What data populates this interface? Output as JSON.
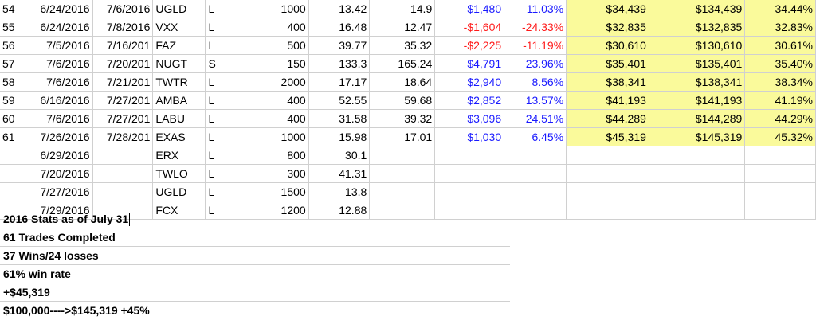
{
  "trades": [
    {
      "num": "54",
      "entry": "6/24/2016",
      "exit": "7/6/2016",
      "ticker": "UGLD",
      "side": "L",
      "shares": "1000",
      "buy": "13.42",
      "sell": "14.9",
      "pl": "$1,480",
      "pct": "11.03%",
      "cum": "$34,439",
      "bal": "$134,439",
      "ytd": "34.44%",
      "sign": "pos"
    },
    {
      "num": "55",
      "entry": "6/24/2016",
      "exit": "7/8/2016",
      "ticker": "VXX",
      "side": "L",
      "shares": "400",
      "buy": "16.48",
      "sell": "12.47",
      "pl": "-$1,604",
      "pct": "-24.33%",
      "cum": "$32,835",
      "bal": "$132,835",
      "ytd": "32.83%",
      "sign": "neg"
    },
    {
      "num": "56",
      "entry": "7/5/2016",
      "exit": "7/16/201",
      "ticker": "FAZ",
      "side": "L",
      "shares": "500",
      "buy": "39.77",
      "sell": "35.32",
      "pl": "-$2,225",
      "pct": "-11.19%",
      "cum": "$30,610",
      "bal": "$130,610",
      "ytd": "30.61%",
      "sign": "neg"
    },
    {
      "num": "57",
      "entry": "7/6/2016",
      "exit": "7/20/201",
      "ticker": "NUGT",
      "side": "S",
      "shares": "150",
      "buy": "133.3",
      "sell": "165.24",
      "pl": "$4,791",
      "pct": "23.96%",
      "cum": "$35,401",
      "bal": "$135,401",
      "ytd": "35.40%",
      "sign": "pos"
    },
    {
      "num": "58",
      "entry": "7/6/2016",
      "exit": "7/21/201",
      "ticker": "TWTR",
      "side": "L",
      "shares": "2000",
      "buy": "17.17",
      "sell": "18.64",
      "pl": "$2,940",
      "pct": "8.56%",
      "cum": "$38,341",
      "bal": "$138,341",
      "ytd": "38.34%",
      "sign": "pos"
    },
    {
      "num": "59",
      "entry": "6/16/2016",
      "exit": "7/27/201",
      "ticker": "AMBA",
      "side": "L",
      "shares": "400",
      "buy": "52.55",
      "sell": "59.68",
      "pl": "$2,852",
      "pct": "13.57%",
      "cum": "$41,193",
      "bal": "$141,193",
      "ytd": "41.19%",
      "sign": "pos"
    },
    {
      "num": "60",
      "entry": "7/6/2016",
      "exit": "7/27/201",
      "ticker": "LABU",
      "side": "L",
      "shares": "400",
      "buy": "31.58",
      "sell": "39.32",
      "pl": "$3,096",
      "pct": "24.51%",
      "cum": "$44,289",
      "bal": "$144,289",
      "ytd": "44.29%",
      "sign": "pos"
    },
    {
      "num": "61",
      "entry": "7/26/2016",
      "exit": "7/28/201",
      "ticker": "EXAS",
      "side": "L",
      "shares": "1000",
      "buy": "15.98",
      "sell": "17.01",
      "pl": "$1,030",
      "pct": "6.45%",
      "cum": "$45,319",
      "bal": "$145,319",
      "ytd": "45.32%",
      "sign": "pos"
    }
  ],
  "open_positions": [
    {
      "entry": "6/29/2016",
      "ticker": "ERX",
      "side": "L",
      "shares": "800",
      "buy": "30.1"
    },
    {
      "entry": "7/20/2016",
      "ticker": "TWLO",
      "side": "L",
      "shares": "300",
      "buy": "41.31"
    },
    {
      "entry": "7/27/2016",
      "ticker": "UGLD",
      "side": "L",
      "shares": "1500",
      "buy": "13.8"
    },
    {
      "entry": "7/29/2016",
      "ticker": "FCX",
      "side": "L",
      "shares": "1200",
      "buy": "12.88"
    }
  ],
  "stats": {
    "title": "2016 Stats as of July 31",
    "line1": "61 Trades Completed",
    "line2": "37 Wins/24 losses",
    "line3": "61% win rate",
    "line4": "+$45,319",
    "line5": "$100,000---->$145,319 +45%"
  },
  "colors": {
    "positive": "#1a1aff",
    "negative": "#ff1a1a",
    "highlight": "#fafa9b"
  }
}
